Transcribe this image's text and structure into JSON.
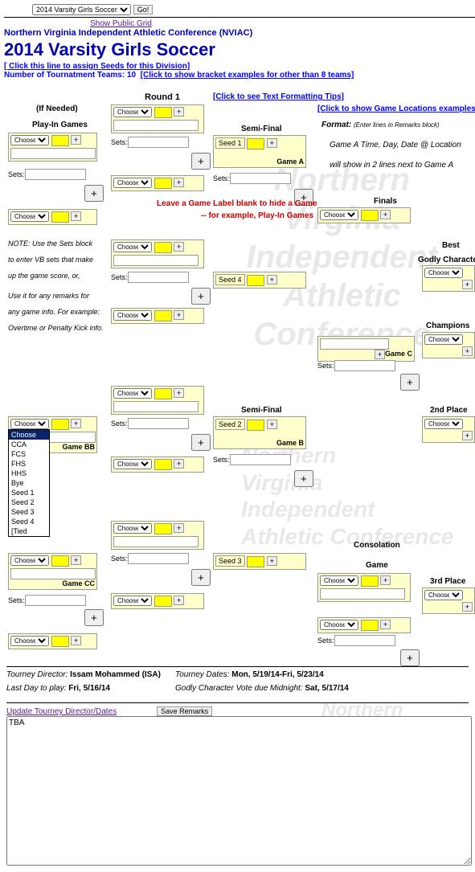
{
  "topSelect": "2014 Varsity Girls Soccer",
  "go": "Go!",
  "showPublic": "Show Public Grid",
  "conference": "Northern Virginia Independent Athletic Conference (NVIAC)",
  "title": "2014 Varsity Girls Soccer",
  "seedsLink": "[ Click this line to assign Seeds for this Division]",
  "numTeamsLabel": "Number of Tournatment Teams: 10",
  "bracketExLink": "[Click to show bracket examples for other than 8 teams]",
  "round1": "Round 1",
  "textFmtLink": "[Click to see Text Formatting Tips]",
  "ifNeeded": "(If Needed)",
  "playIn": "Play-In Games",
  "gameLocLink": "[Click to show Game Locations examples]",
  "formatLabel": "Format:",
  "formatHint": "(Enter lines in Remarks block)",
  "fmtLine1": "Game A Time, Day, Date @ Location",
  "fmtLine2": "will show in 2 lines next to Game A",
  "semiFinal": "Semi-Final",
  "finals": "Finals",
  "choose": "Choose",
  "sets": "Sets:",
  "seed1": "Seed 1",
  "seed2": "Seed 2",
  "seed3": "Seed 3",
  "seed4": "Seed 4",
  "gameA": "Game A",
  "gameB": "Game B",
  "gameC": "Game C",
  "gameBB": "Game BB",
  "gameCC": "Game CC",
  "hideNote1": "Leave a Game Label blank to hide a Game",
  "hideNote2": "-- for example,  Play-In Games",
  "noteUse1": "NOTE: Use the Sets block",
  "noteUse2": "to enter VB sets that make",
  "noteUse3": "up the game score, or,",
  "noteUse4": "Use it for any remarks for",
  "noteUse5": "any game info. For example:",
  "noteUse6": "Overtime or Penalty Kick info.",
  "best": "Best",
  "godly": "Godly Character",
  "champions": "Champions",
  "place2": "2nd Place",
  "consolation": "Consolation",
  "game": "Game",
  "place3": "3rd Place",
  "dropOptions": [
    "Choose",
    "CCA",
    "FCS",
    "FHS",
    "HHS",
    "Bye",
    "Seed 1",
    "Seed 2",
    "Seed 3",
    "Seed 4",
    "[Tied"
  ],
  "directorLabel": "Tourney Director:",
  "director": "Issam Mohammed (ISA)",
  "datesLabel": "Tourney Dates:",
  "dates": "Mon, 5/19/14-Fri, 5/23/14",
  "lastDayLabel": "Last Day to play:",
  "lastDay": "Fri, 5/16/14",
  "voteLabel": "Godly Character Vote due Midnight:",
  "voteDate": "Sat, 5/17/14",
  "updateLink": "Update Tourney Director/Dates",
  "saveRemarks": "Save Remarks",
  "remarksText": "TBA"
}
